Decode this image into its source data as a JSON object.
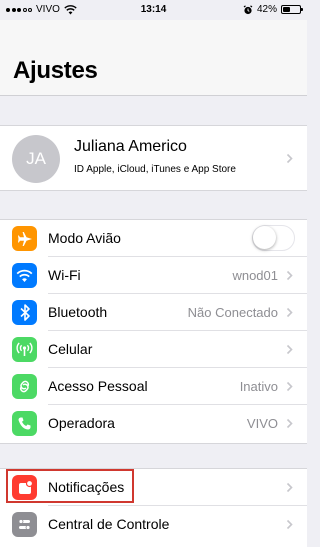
{
  "status_bar": {
    "carrier": "VIVO",
    "time": "13:14",
    "battery": "42%",
    "battery_level": 0.42
  },
  "header": {
    "title": "Ajustes"
  },
  "profile": {
    "initials": "JA",
    "name": "Juliana Americo",
    "subtitle": "ID Apple, iCloud, iTunes e App Store"
  },
  "settings_group_1": [
    {
      "label": "Modo Avião",
      "icon": "airplane-icon",
      "color": "#ff9500",
      "toggle": false
    },
    {
      "label": "Wi-Fi",
      "icon": "wifi-icon",
      "color": "#007aff",
      "value": "wnod01"
    },
    {
      "label": "Bluetooth",
      "icon": "bluetooth-icon",
      "color": "#007aff",
      "value": "Não Conectado"
    },
    {
      "label": "Celular",
      "icon": "cellular-icon",
      "color": "#4cd964",
      "value": ""
    },
    {
      "label": "Acesso Pessoal",
      "icon": "hotspot-icon",
      "color": "#4cd964",
      "value": "Inativo"
    },
    {
      "label": "Operadora",
      "icon": "phone-icon",
      "color": "#4cd964",
      "value": "VIVO"
    }
  ],
  "settings_group_2": [
    {
      "label": "Notificações",
      "icon": "notifications-icon",
      "color": "#ff3b30",
      "highlighted": true
    },
    {
      "label": "Central de Controle",
      "icon": "control-center-icon",
      "color": "#8e8e93"
    }
  ]
}
